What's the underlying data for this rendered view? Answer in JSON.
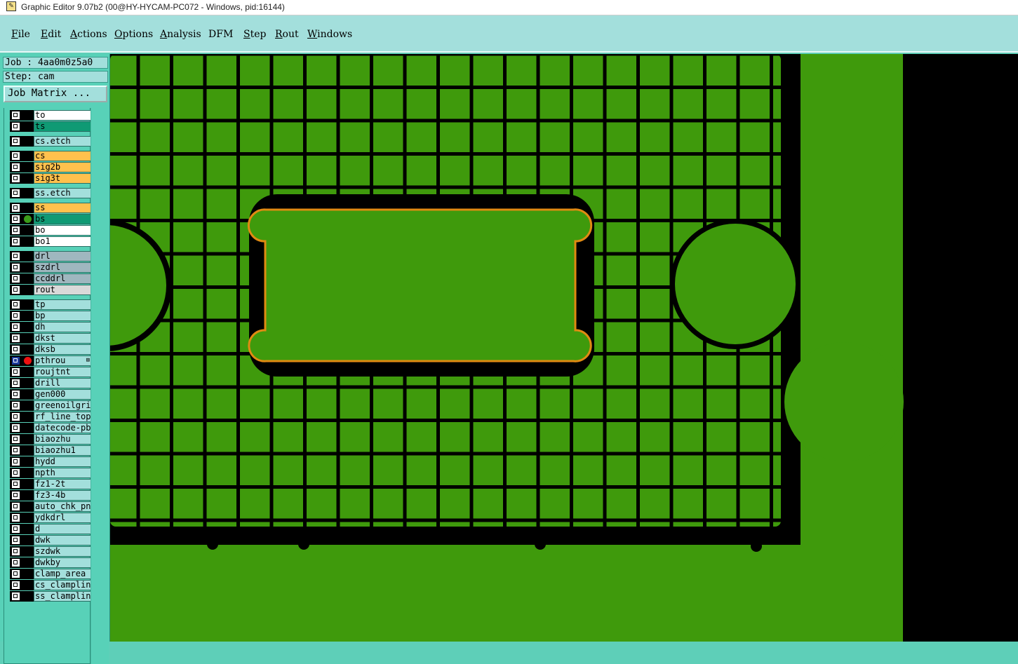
{
  "window": {
    "title": "Graphic Editor 9.07b2 (00@HY-HYCAM-PC072 - Windows, pid:16144)"
  },
  "menu": [
    {
      "pre": "",
      "ul": "F",
      "post": "ile"
    },
    {
      "pre": "",
      "ul": "E",
      "post": "dit"
    },
    {
      "pre": "",
      "ul": "A",
      "post": "ctions"
    },
    {
      "pre": "",
      "ul": "O",
      "post": "ptions"
    },
    {
      "pre": "",
      "ul": "A",
      "post": "nalysis"
    },
    {
      "pre": "DFM",
      "ul": "",
      "post": ""
    },
    {
      "pre": "",
      "ul": "S",
      "post": "tep"
    },
    {
      "pre": "",
      "ul": "R",
      "post": "out"
    },
    {
      "pre": "",
      "ul": "W",
      "post": "indows"
    }
  ],
  "job": {
    "label": "Job : 4aa0m0z5a0"
  },
  "step": {
    "label": "Step: cam"
  },
  "job_matrix": {
    "label": "Job Matrix ..."
  },
  "layers": [
    {
      "name": "to",
      "color": "#ffffff",
      "marker": ""
    },
    {
      "name": "ts",
      "color": "#0f9a74",
      "marker": ""
    },
    {
      "name": "cs.etch",
      "color": "#a3dfdc",
      "marker": "",
      "gap": true
    },
    {
      "name": "cs",
      "color": "#ffc14d",
      "marker": "",
      "gap": true
    },
    {
      "name": "sig2b",
      "color": "#ffc14d",
      "marker": ""
    },
    {
      "name": "sig3t",
      "color": "#ffc14d",
      "marker": ""
    },
    {
      "name": "ss.etch",
      "color": "#a3dfdc",
      "marker": "",
      "gap": true
    },
    {
      "name": "ss",
      "color": "#ffc14d",
      "marker": "",
      "gap": true
    },
    {
      "name": "bs",
      "color": "#0f9a74",
      "marker": "#3a9c1a"
    },
    {
      "name": "bo",
      "color": "#ffffff",
      "marker": ""
    },
    {
      "name": "bo1",
      "color": "#ffffff",
      "marker": ""
    },
    {
      "name": "drl",
      "color": "#9fb7bf",
      "marker": "",
      "gap": true
    },
    {
      "name": "szdrl",
      "color": "#9fb7bf",
      "marker": ""
    },
    {
      "name": "ccddrl",
      "color": "#9fb7bf",
      "marker": ""
    },
    {
      "name": "rout",
      "color": "#d9d9d9",
      "marker": ""
    },
    {
      "name": "tp",
      "color": "#a3dfdc",
      "marker": "",
      "gap": true
    },
    {
      "name": "bp",
      "color": "#a3dfdc",
      "marker": ""
    },
    {
      "name": "dh",
      "color": "#a3dfdc",
      "marker": ""
    },
    {
      "name": "dkst",
      "color": "#a3dfdc",
      "marker": ""
    },
    {
      "name": "dksb",
      "color": "#a3dfdc",
      "marker": ""
    },
    {
      "name": "pthrou",
      "color": "#a3dfdc",
      "marker": "#ee1111",
      "selected": true,
      "more": "⊞"
    },
    {
      "name": "roujtnt",
      "color": "#a3dfdc",
      "marker": ""
    },
    {
      "name": "drill",
      "color": "#a3dfdc",
      "marker": ""
    },
    {
      "name": "gen000",
      "color": "#a3dfdc",
      "marker": ""
    },
    {
      "name": "greenoilgrid",
      "color": "#a3dfdc",
      "marker": ""
    },
    {
      "name": "rf_line_top",
      "color": "#a3dfdc",
      "marker": ""
    },
    {
      "name": "datecode-pbe",
      "color": "#a3dfdc",
      "marker": ""
    },
    {
      "name": "biaozhu",
      "color": "#a3dfdc",
      "marker": ""
    },
    {
      "name": "biaozhu1",
      "color": "#a3dfdc",
      "marker": ""
    },
    {
      "name": "hydd",
      "color": "#a3dfdc",
      "marker": ""
    },
    {
      "name": "npth",
      "color": "#a3dfdc",
      "marker": ""
    },
    {
      "name": "fz1-2t",
      "color": "#a3dfdc",
      "marker": ""
    },
    {
      "name": "fz3-4b",
      "color": "#a3dfdc",
      "marker": ""
    },
    {
      "name": "auto_chk_pnl",
      "color": "#a3dfdc",
      "marker": ""
    },
    {
      "name": "ydkdrl",
      "color": "#a3dfdc",
      "marker": ""
    },
    {
      "name": "d",
      "color": "#a3dfdc",
      "marker": ""
    },
    {
      "name": "dwk",
      "color": "#a3dfdc",
      "marker": ""
    },
    {
      "name": "szdwk",
      "color": "#a3dfdc",
      "marker": ""
    },
    {
      "name": "dwkby",
      "color": "#a3dfdc",
      "marker": ""
    },
    {
      "name": "clamp_area",
      "color": "#a3dfdc",
      "marker": ""
    },
    {
      "name": "cs_clampline",
      "color": "#a3dfdc",
      "marker": ""
    },
    {
      "name": "ss_clampline",
      "color": "#a3dfdc",
      "marker": ""
    }
  ],
  "canvas_colors": {
    "fill": "#3f9a0c",
    "background": "#000000",
    "highlight": "#e08a12"
  }
}
